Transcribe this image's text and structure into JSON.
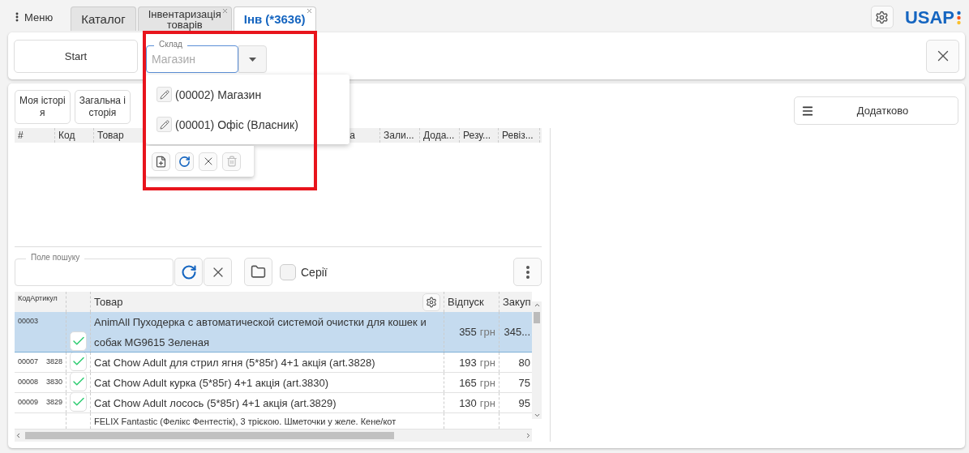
{
  "top_bar": {
    "menu_label": "Меню",
    "tabs": [
      {
        "lines": [
          "Каталог"
        ],
        "selected": false,
        "closable": false
      },
      {
        "lines": [
          "Інвентаризація",
          "товарів"
        ],
        "selected": false,
        "closable": true
      },
      {
        "lines": [
          "Інв (*3636)"
        ],
        "selected": true,
        "closable": true
      }
    ],
    "logo": "USAP"
  },
  "header_panel": {
    "start_button": "Start",
    "warehouse_field": {
      "label": "Склад",
      "placeholder": "Магазин"
    },
    "dropdown": {
      "options": [
        "(00002) Магазин",
        "(00001) Офіс (Власник)"
      ]
    }
  },
  "history": {
    "buttons": [
      {
        "lines": [
          "Моя історі",
          "я"
        ]
      },
      {
        "lines": [
          "Загальна і",
          "сторія"
        ]
      }
    ],
    "columns": [
      "#",
      "Код",
      "Товар",
      "а",
      "Зали...",
      "Дода...",
      "Резу...",
      "Ревіз..."
    ]
  },
  "additional_button": "Додатково",
  "search": {
    "label": "Поле пошуку"
  },
  "series_checkbox": {
    "label": "Серії",
    "checked": false
  },
  "products": {
    "columns": {
      "code_sku": "КодАртикул",
      "product": "Товар",
      "sale": "Відпуск",
      "purchase": "Закуп"
    },
    "rows": [
      {
        "code": "00003",
        "sku": "",
        "checked": true,
        "name": "AnimAll Пуходерка с автоматической системой очистки для кошек и собак MG9615 Зеленая",
        "sale": "355",
        "currency": "грн",
        "purchase": "345...",
        "selected": true
      },
      {
        "code": "00007",
        "sku": "3828",
        "checked": true,
        "name": "Cat Chow Adult для стрил ягня (5*85г) 4+1 акція (art.3828)",
        "sale": "193",
        "currency": "грн",
        "purchase": "80",
        "selected": false
      },
      {
        "code": "00008",
        "sku": "3830",
        "checked": true,
        "name": "Cat Chow Adult курка (5*85г) 4+1 акція (art.3830)",
        "sale": "165",
        "currency": "грн",
        "purchase": "75",
        "selected": false
      },
      {
        "code": "00009",
        "sku": "3829",
        "checked": true,
        "name": "Cat Chow Adult лосось (5*85г) 4+1 акція (art.3829)",
        "sale": "130",
        "currency": "грн",
        "purchase": "95",
        "selected": false
      },
      {
        "code": "",
        "sku": "",
        "name": "FELIX Fantastic (Фелікс Фентестік), 3 трієкою. Шметочки у желе. Кене/кот",
        "sale": "",
        "currency": "",
        "purchase": "",
        "selected": false
      }
    ]
  }
}
